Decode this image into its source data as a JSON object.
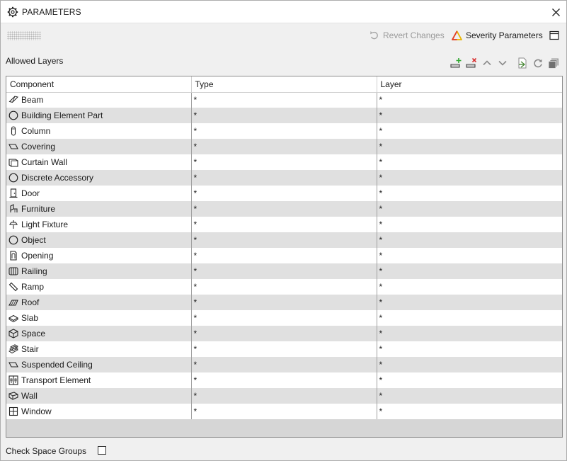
{
  "window": {
    "title": "PARAMETERS"
  },
  "toolbar": {
    "revert_label": "Revert Changes",
    "severity_label": "Severity Parameters"
  },
  "section": {
    "label": "Allowed Layers"
  },
  "table": {
    "headers": [
      "Component",
      "Type",
      "Layer"
    ],
    "rows": [
      {
        "component": "Beam",
        "icon": "beam-icon",
        "type": "*",
        "layer": "*"
      },
      {
        "component": "Building Element Part",
        "icon": "circle-icon",
        "type": "*",
        "layer": "*"
      },
      {
        "component": "Column",
        "icon": "column-icon",
        "type": "*",
        "layer": "*"
      },
      {
        "component": "Covering",
        "icon": "covering-icon",
        "type": "*",
        "layer": "*"
      },
      {
        "component": "Curtain Wall",
        "icon": "curtain-wall-icon",
        "type": "*",
        "layer": "*"
      },
      {
        "component": "Discrete Accessory",
        "icon": "circle-icon",
        "type": "*",
        "layer": "*"
      },
      {
        "component": "Door",
        "icon": "door-icon",
        "type": "*",
        "layer": "*"
      },
      {
        "component": "Furniture",
        "icon": "furniture-icon",
        "type": "*",
        "layer": "*"
      },
      {
        "component": "Light Fixture",
        "icon": "light-fixture-icon",
        "type": "*",
        "layer": "*"
      },
      {
        "component": "Object",
        "icon": "circle-icon",
        "type": "*",
        "layer": "*"
      },
      {
        "component": "Opening",
        "icon": "opening-icon",
        "type": "*",
        "layer": "*"
      },
      {
        "component": "Railing",
        "icon": "railing-icon",
        "type": "*",
        "layer": "*"
      },
      {
        "component": "Ramp",
        "icon": "ramp-icon",
        "type": "*",
        "layer": "*"
      },
      {
        "component": "Roof",
        "icon": "roof-icon",
        "type": "*",
        "layer": "*"
      },
      {
        "component": "Slab",
        "icon": "slab-icon",
        "type": "*",
        "layer": "*"
      },
      {
        "component": "Space",
        "icon": "space-icon",
        "type": "*",
        "layer": "*"
      },
      {
        "component": "Stair",
        "icon": "stair-icon",
        "type": "*",
        "layer": "*"
      },
      {
        "component": "Suspended Ceiling",
        "icon": "covering-icon",
        "type": "*",
        "layer": "*"
      },
      {
        "component": "Transport Element",
        "icon": "transport-element-icon",
        "type": "*",
        "layer": "*"
      },
      {
        "component": "Wall",
        "icon": "wall-icon",
        "type": "*",
        "layer": "*"
      },
      {
        "component": "Window",
        "icon": "window-icon",
        "type": "*",
        "layer": "*"
      }
    ]
  },
  "footer": {
    "check_label": "Check Space Groups",
    "checked": false
  },
  "colors": {
    "severity_accent": "#e8b400",
    "add_accent": "#2fa82f",
    "remove_accent": "#d83030"
  }
}
